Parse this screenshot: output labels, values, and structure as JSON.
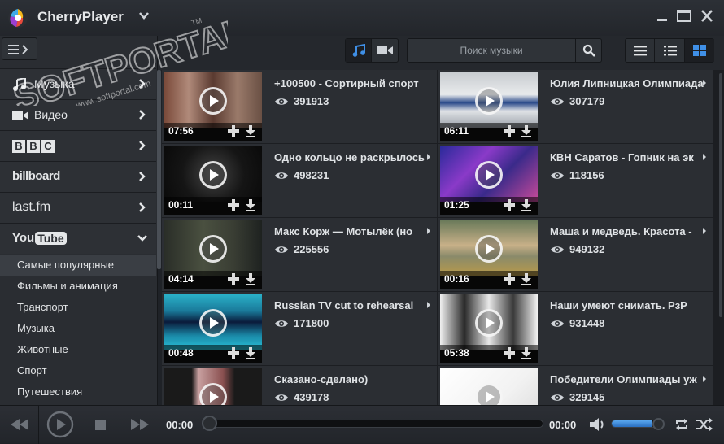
{
  "window": {
    "title": "CherryPlayer"
  },
  "toolbar": {
    "search_placeholder": "Поиск музыки"
  },
  "sidebar": {
    "items": [
      {
        "label": "Музыка",
        "icon": "music-note-icon"
      },
      {
        "label": "Видео",
        "icon": "video-camera-icon"
      },
      {
        "label": "BBC",
        "icon": "bbc-logo"
      },
      {
        "label": "billboard",
        "icon": "billboard-logo"
      },
      {
        "label": "last.fm",
        "icon": "lastfm-logo"
      },
      {
        "label": "YouTube",
        "icon": "youtube-logo"
      }
    ],
    "subitems": [
      "Самые популярные",
      "Фильмы и анимация",
      "Транспорт",
      "Музыка",
      "Животные",
      "Спорт",
      "Путешествия"
    ],
    "active_subitem": "Самые популярные"
  },
  "videos": [
    {
      "title": "+100500 - Сортирный спорт",
      "views": "391913",
      "duration": "07:56"
    },
    {
      "title": "Юлия Липницкая  Олимпиада",
      "views": "307179",
      "duration": "06:11"
    },
    {
      "title": "Одно кольцо не раскрылось",
      "views": "498231",
      "duration": "00:11"
    },
    {
      "title": "КВН Саратов - Гопник на эк",
      "views": "118156",
      "duration": "01:25"
    },
    {
      "title": "Макс Корж — Мотылёк (но",
      "views": "225556",
      "duration": "04:14"
    },
    {
      "title": "Маша и медведь. Красота -",
      "views": "949132",
      "duration": "00:16"
    },
    {
      "title": "Russian TV cut to rehearsal",
      "views": "171800",
      "duration": "00:48"
    },
    {
      "title": "Наши умеют снимать. РзР",
      "views": "931448",
      "duration": "05:38"
    },
    {
      "title": "Сказано-сделано)",
      "views": "439178",
      "duration": ""
    },
    {
      "title": "Победители Олимпиады уж",
      "views": "329145",
      "duration": ""
    }
  ],
  "player": {
    "current_time": "00:00",
    "total_time": "00:00",
    "progress": 0,
    "volume": 0.85
  },
  "watermark": {
    "text": "SOFTPORTAL",
    "tm": "TM",
    "url": "www.softportal.com"
  },
  "colors": {
    "accent": "#3f8fe6",
    "background": "#1f2227",
    "panel": "#2b2e33"
  }
}
